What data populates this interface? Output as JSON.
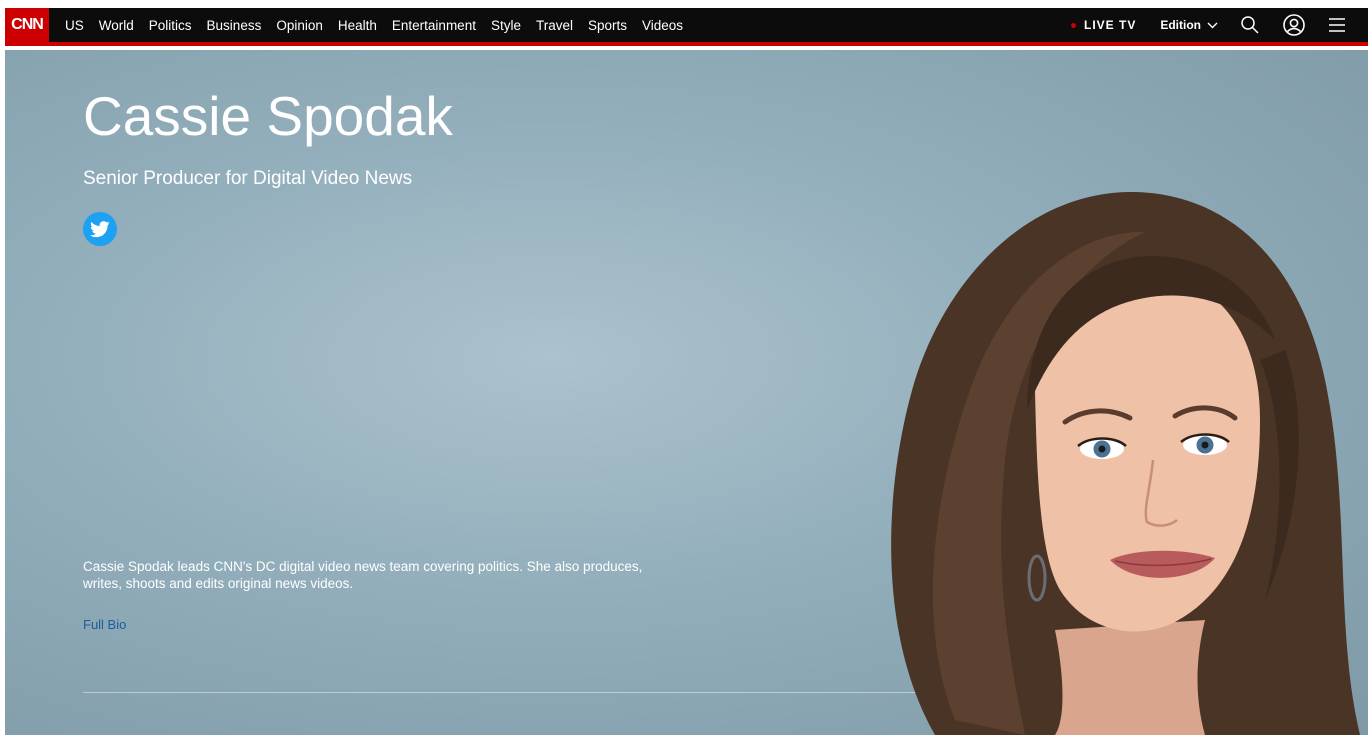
{
  "nav": {
    "logo_text": "CNN",
    "links": [
      "US",
      "World",
      "Politics",
      "Business",
      "Opinion",
      "Health",
      "Entertainment",
      "Style",
      "Travel",
      "Sports",
      "Videos"
    ],
    "live_tv": "LIVE TV",
    "edition": "Edition",
    "icons": [
      "search-icon",
      "account-icon",
      "menu-icon"
    ]
  },
  "profile": {
    "name": "Cassie Spodak",
    "title": "Senior Producer for Digital Video News",
    "bio": "Cassie Spodak leads CNN's DC digital video news team covering politics. She also produces, writes, shoots and edits original news videos.",
    "full_bio_label": "Full Bio",
    "social_icon": "twitter-icon"
  },
  "colors": {
    "brand_red": "#cc0000",
    "nav_bg": "#0c0c0c",
    "link_blue": "#1d5c9c",
    "twitter_blue": "#1da1f2"
  }
}
